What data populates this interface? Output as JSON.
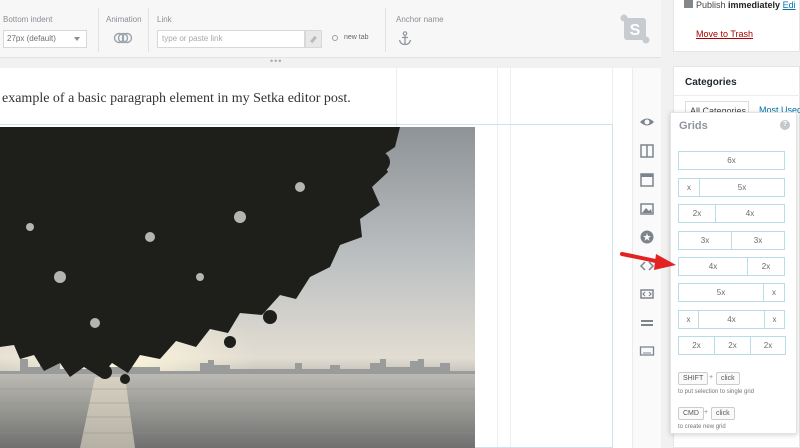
{
  "toolbar": {
    "bottom_indent": {
      "label": "Bottom indent",
      "value": "27px (default)"
    },
    "animation": {
      "label": "Animation"
    },
    "link": {
      "label": "Link",
      "placeholder": "type or paste link",
      "new_tab_label": "new tab"
    },
    "anchor": {
      "label": "Anchor name"
    }
  },
  "canvas": {
    "paragraph": "example of a basic paragraph element in my Setka editor post."
  },
  "side_icons": [
    "eye-icon",
    "columns-icon",
    "layout-icon",
    "image-icon",
    "star-icon",
    "code-icon",
    "embed-icon",
    "divider-icon",
    "keyboard-icon"
  ],
  "wp_sidebar": {
    "publish_prefix": "Publish ",
    "publish_bold": "immediately",
    "publish_edit": "Edi",
    "move_to_trash": "Move to Trash",
    "categories": {
      "title": "Categories",
      "tab_all": "All Categories",
      "tab_most": "Most Used"
    }
  },
  "grids": {
    "title": "Grids",
    "help": "?",
    "rows": [
      [
        "6x"
      ],
      [
        "x",
        "5x"
      ],
      [
        "2x",
        "4x"
      ],
      [
        "3x",
        "3x"
      ],
      [
        "4x",
        "2x"
      ],
      [
        "5x",
        "x"
      ],
      [
        "x",
        "4x",
        "x"
      ],
      [
        "2x",
        "2x",
        "2x"
      ]
    ],
    "shortcut1": {
      "key": "SHIFT",
      "plus": "+",
      "action": "click",
      "hint": "to put selection to single grid"
    },
    "shortcut2": {
      "key": "CMD",
      "plus": "+",
      "action": "click",
      "hint": "to create new grid"
    }
  },
  "colors": {
    "accent_blue": "#0073aa",
    "trash_red": "#a00",
    "grid_border": "#b8dde6",
    "arrow_red": "#e32222"
  }
}
